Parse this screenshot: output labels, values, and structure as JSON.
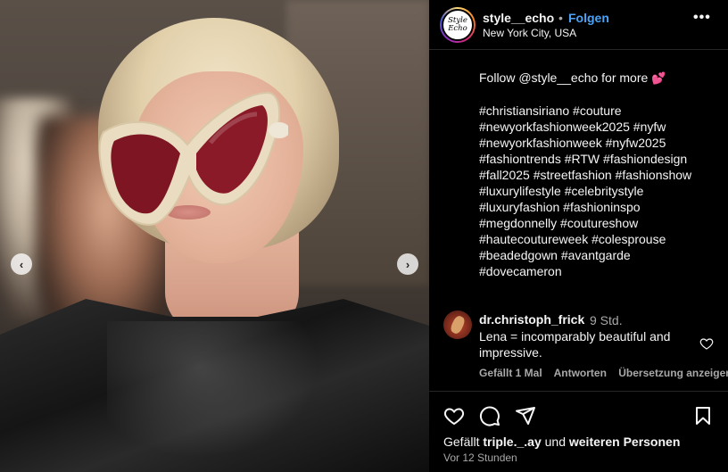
{
  "post": {
    "username": "style__echo",
    "separator": "•",
    "follow_label": "Folgen",
    "location": "New York City, USA",
    "avatar_text": "Style Echo",
    "more_icon": "more-horizontal-icon",
    "caption": {
      "first_line": "Follow @style__echo for more",
      "emoji": "💕",
      "hashtags": [
        "#christiansiriano #couture",
        "#newyorkfashionweek2025 #nyfw",
        "#newyorkfashionweek #nyfw2025",
        "#fashiontrends #RTW #fashiondesign",
        "#fall2025 #streetfashion #fashionshow",
        "#luxurylifestyle #celebritystyle",
        "#luxuryfashion #fashioninspo",
        "#megdonnelly #coutureshow",
        "#hautecoutureweek #colesprouse",
        "#beadedgown #avantgarde",
        "#dovecameron"
      ]
    }
  },
  "comment": {
    "username": "dr.christoph_frick",
    "time": "9 Std.",
    "text": "Lena = incomparably beautiful and impressive.",
    "likes": "Gefällt 1 Mal",
    "reply": "Antworten",
    "translate": "Übersetzung anzeigen"
  },
  "footer": {
    "likes_prefix": "Gefällt",
    "likes_user": "triple._.ay",
    "likes_middle": "und",
    "likes_rest": "weiteren Personen",
    "time_ago": "Vor 12 Stunden"
  },
  "media": {
    "prev_icon": "chevron-left-icon",
    "next_icon": "chevron-right-icon",
    "prev_glyph": "‹",
    "next_glyph": "›"
  },
  "colors": {
    "accent": "#4ca3f5",
    "text": "#f5f5f5",
    "muted": "#a8a8a8",
    "background": "#000000"
  }
}
